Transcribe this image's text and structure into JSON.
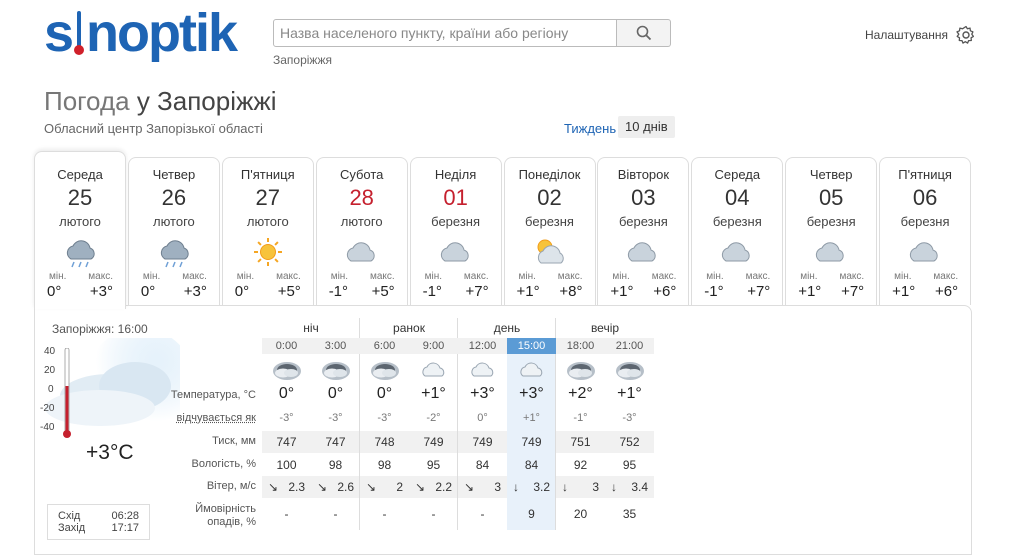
{
  "header": {
    "logo_text": "sinoptik",
    "search_placeholder": "Назва населеного пункту, країни або регіону",
    "search_icon": "search-icon",
    "city_hint": "Запоріжжя",
    "settings_label": "Налаштування",
    "settings_icon": "gear-icon"
  },
  "title": {
    "prefix": "Погода",
    "main": "у Запоріжжі",
    "subtitle": "Обласний центр Запорізької області",
    "week_link": "Тиждень",
    "ten_days": "10 днів"
  },
  "days": [
    {
      "name": "Середа",
      "num": "25",
      "month": "лютого",
      "icon": "rain-snow-icon",
      "min_label": "мін.",
      "max_label": "макс.",
      "min": "0°",
      "max": "+3°"
    },
    {
      "name": "Четвер",
      "num": "26",
      "month": "лютого",
      "icon": "rain-snow-icon",
      "min_label": "мін.",
      "max_label": "макс.",
      "min": "0°",
      "max": "+3°"
    },
    {
      "name": "П'ятниця",
      "num": "27",
      "month": "лютого",
      "icon": "sun-icon",
      "min_label": "мін.",
      "max_label": "макс.",
      "min": "0°",
      "max": "+5°"
    },
    {
      "name": "Субота",
      "num": "28",
      "month": "лютого",
      "icon": "cloudy-icon",
      "min_label": "мін.",
      "max_label": "макс.",
      "min": "-1°",
      "max": "+5°",
      "red": true
    },
    {
      "name": "Неділя",
      "num": "01",
      "month": "березня",
      "icon": "cloudy-icon",
      "min_label": "мін.",
      "max_label": "макс.",
      "min": "-1°",
      "max": "+7°",
      "red": true
    },
    {
      "name": "Понеділок",
      "num": "02",
      "month": "березня",
      "icon": "partly-cloudy-icon",
      "min_label": "мін.",
      "max_label": "макс.",
      "min": "+1°",
      "max": "+8°"
    },
    {
      "name": "Вівторок",
      "num": "03",
      "month": "березня",
      "icon": "cloudy-icon",
      "min_label": "мін.",
      "max_label": "макс.",
      "min": "+1°",
      "max": "+6°"
    },
    {
      "name": "Середа",
      "num": "04",
      "month": "березня",
      "icon": "cloudy-icon",
      "min_label": "мін.",
      "max_label": "макс.",
      "min": "-1°",
      "max": "+7°"
    },
    {
      "name": "Четвер",
      "num": "05",
      "month": "березня",
      "icon": "cloudy-icon",
      "min_label": "мін.",
      "max_label": "макс.",
      "min": "+1°",
      "max": "+7°"
    },
    {
      "name": "П'ятниця",
      "num": "06",
      "month": "березня",
      "icon": "cloudy-icon",
      "min_label": "мін.",
      "max_label": "макс.",
      "min": "+1°",
      "max": "+6°"
    }
  ],
  "current": {
    "label": "Запоріжжя: 16:00",
    "scale": [
      "40",
      "20",
      "0",
      "-20",
      "-40"
    ],
    "temp": "+3°C",
    "sunrise_label": "Схід",
    "sunrise": "06:28",
    "sunset_label": "Захід",
    "sunset": "17:17"
  },
  "periods": [
    "ніч",
    "ранок",
    "день",
    "вечір"
  ],
  "hours": [
    "0:00",
    "3:00",
    "6:00",
    "9:00",
    "12:00",
    "15:00",
    "18:00",
    "21:00"
  ],
  "current_hour_index": 5,
  "row_labels": {
    "temp": "Температура, °С",
    "feels": "відчувається як",
    "pressure": "Тиск, мм",
    "humidity": "Вологість, %",
    "wind": "Вітер, м/с",
    "precip_1": "Ймовірність",
    "precip_2": "опадів, %"
  },
  "hourly": {
    "icons": [
      "night-cloud-icon",
      "night-cloud-icon",
      "night-cloud-icon",
      "overcast-icon",
      "overcast-icon",
      "overcast-icon",
      "night-cloud-icon",
      "night-cloud-icon"
    ],
    "temp": [
      "0°",
      "0°",
      "0°",
      "+1°",
      "+3°",
      "+3°",
      "+2°",
      "+1°"
    ],
    "feels": [
      "-3°",
      "-3°",
      "-3°",
      "-2°",
      "0°",
      "+1°",
      "-1°",
      "-3°"
    ],
    "pressure": [
      "747",
      "747",
      "748",
      "749",
      "749",
      "749",
      "751",
      "752"
    ],
    "humidity": [
      "100",
      "98",
      "98",
      "95",
      "84",
      "84",
      "92",
      "95"
    ],
    "wind_dir": [
      "↘",
      "↘",
      "↘",
      "↘",
      "↘",
      "↓",
      "↓",
      "↓"
    ],
    "wind": [
      "2.3",
      "2.6",
      "2",
      "2.2",
      "3",
      "3.2",
      "3",
      "3.4"
    ],
    "precip": [
      "-",
      "-",
      "-",
      "-",
      "-",
      "9",
      "20",
      "35"
    ]
  },
  "colors": {
    "brand": "#1e64b4",
    "holiday": "#c5202e",
    "current_hour": "#5b9bd5"
  }
}
